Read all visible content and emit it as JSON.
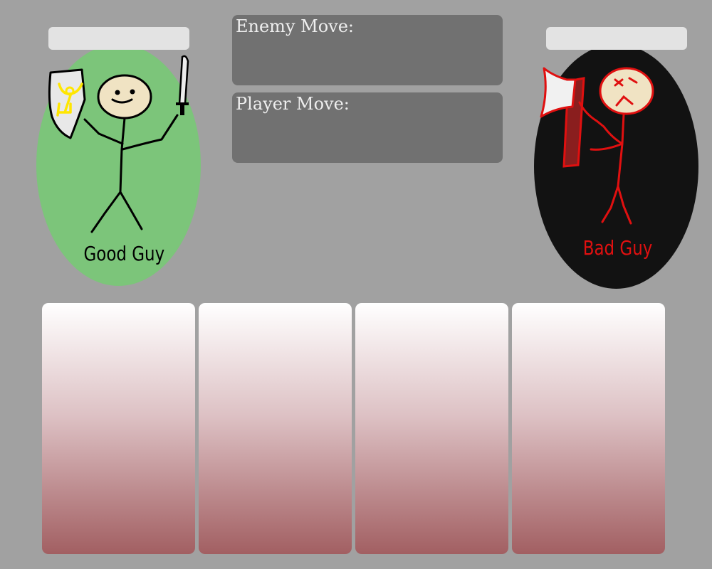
{
  "player": {
    "name": "Good Guy",
    "health": "",
    "ellipse_color": "#7cc57a",
    "name_color": "#000000",
    "weapon": "sword-icon",
    "shield": "shield-icon"
  },
  "enemy": {
    "name": "Bad Guy",
    "health": "",
    "ellipse_color": "#121212",
    "name_color": "#e01010",
    "weapon": "axe-icon"
  },
  "moves": {
    "enemy_label": "Enemy Move:",
    "enemy_value": "",
    "player_label": "Player Move:",
    "player_value": ""
  },
  "cards": [
    {
      "label": ""
    },
    {
      "label": ""
    },
    {
      "label": ""
    },
    {
      "label": ""
    }
  ],
  "colors": {
    "background": "#a1a1a1",
    "move_box": "#717171",
    "health_bar": "#e3e3e3",
    "card_top": "#ffffff",
    "card_bottom": "#a25f62"
  }
}
